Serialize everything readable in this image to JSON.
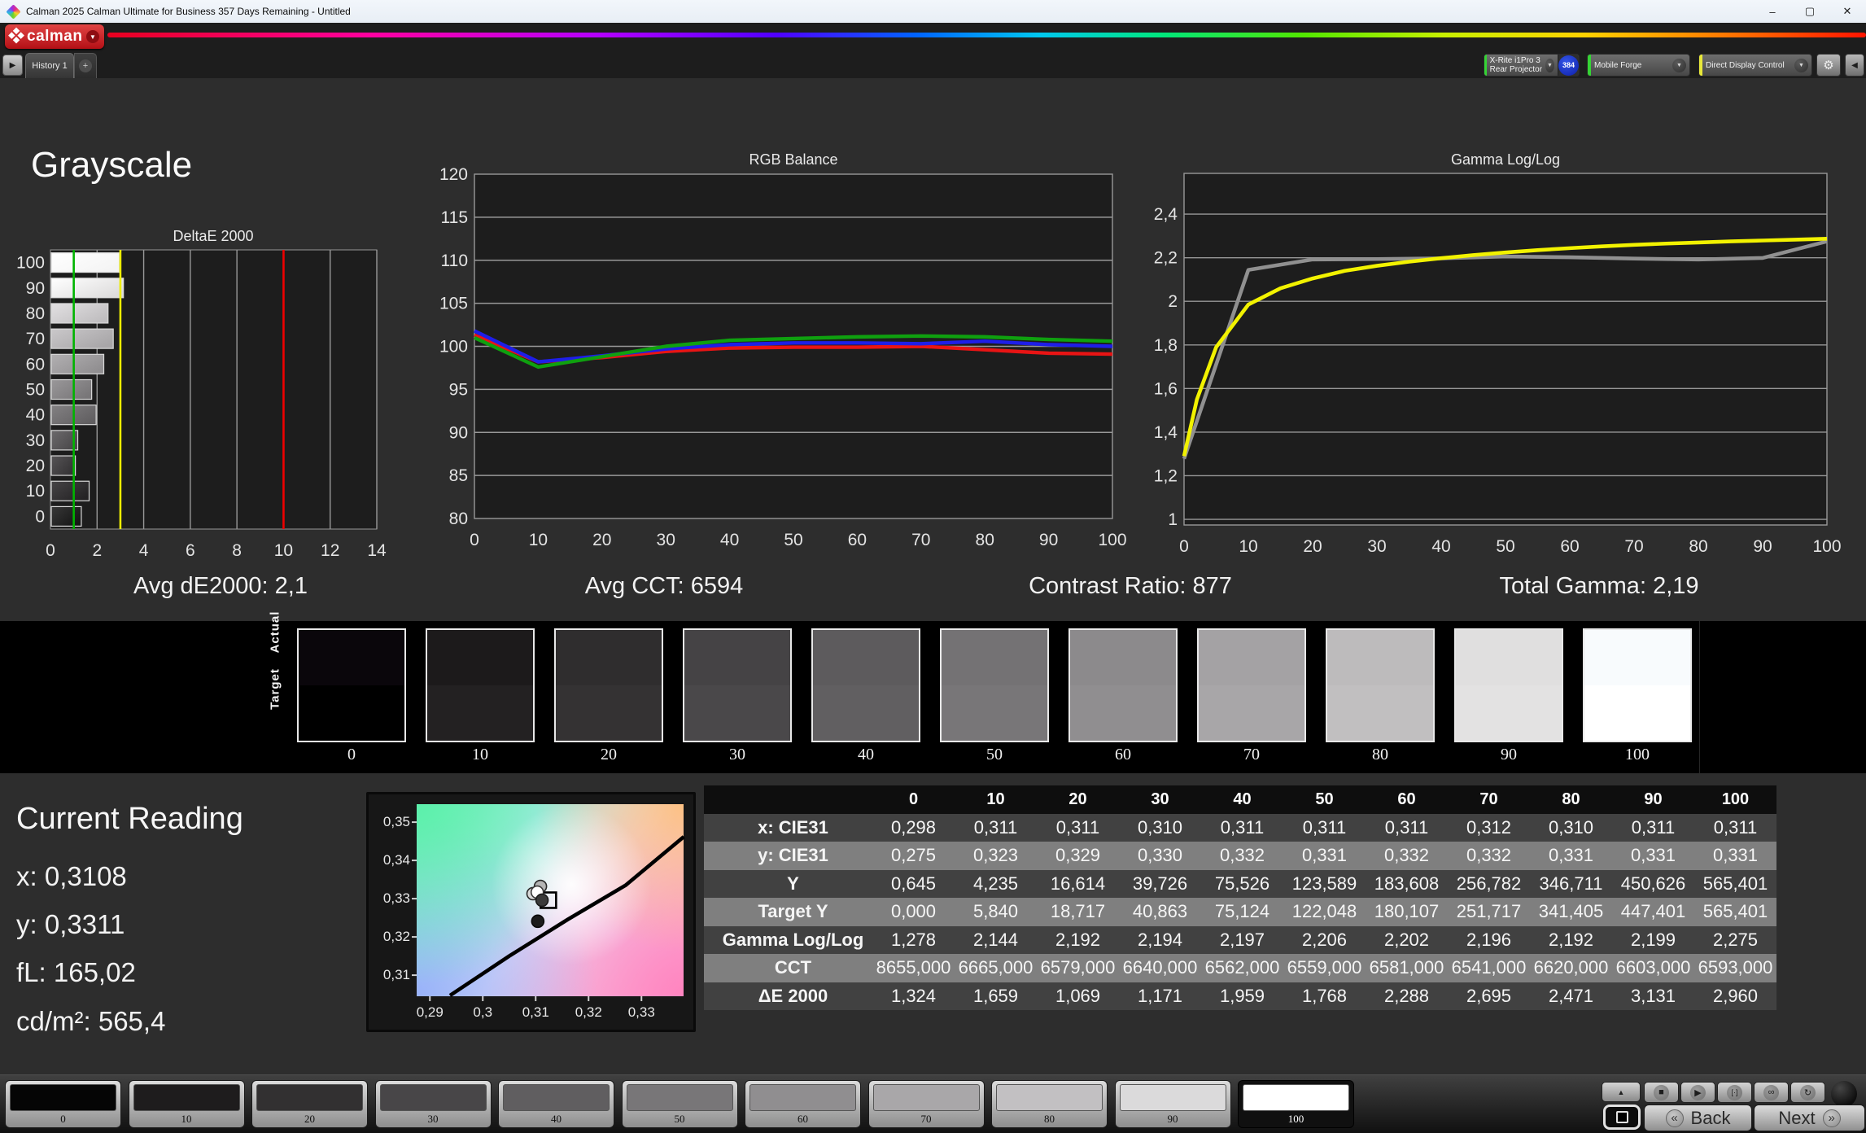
{
  "window": {
    "title": "Calman 2025 Calman Ultimate for Business 357 Days Remaining  - Untitled",
    "minimize": "–",
    "maximize": "▢",
    "close": "✕"
  },
  "brand": {
    "logo_text": "calman",
    "dropdown_glyph": "▼"
  },
  "toolbar": {
    "expander_glyph": "▶",
    "history_tab": "History 1",
    "add_tab": "+",
    "meter": {
      "line1": "X-Rite i1Pro 3",
      "line2": "Rear Projector",
      "badge": "384",
      "stripe_color": "#35d435"
    },
    "source": {
      "label": "Mobile Forge",
      "stripe_color": "#35d435"
    },
    "display": {
      "label": "Direct Display Control",
      "stripe_color": "#e8e83a"
    },
    "gear_glyph": "⚙",
    "collapse_glyph": "◀",
    "arrow_glyph": "▼"
  },
  "page": {
    "title": "Grayscale"
  },
  "chart_data": [
    {
      "type": "bar",
      "title": "DeltaE 2000",
      "orientation": "horizontal",
      "categories": [
        0,
        10,
        20,
        30,
        40,
        50,
        60,
        70,
        80,
        90,
        100
      ],
      "values": [
        1.324,
        1.659,
        1.069,
        1.171,
        1.959,
        1.768,
        2.288,
        2.695,
        2.471,
        3.131,
        2.96
      ],
      "bar_colors": [
        "#161616",
        "#242224",
        "#343234",
        "#4a484a",
        "#615f61",
        "#787678",
        "#908e90",
        "#a8a6a8",
        "#c0bec0",
        "#dedddd",
        "#f4f4f4"
      ],
      "xlabel": "",
      "ylabel": "",
      "xlim": [
        0,
        14
      ],
      "xticks": [
        "0",
        "2",
        "4",
        "6",
        "8",
        "10",
        "12",
        "14"
      ],
      "reference_lines": [
        {
          "value": 1,
          "color": "#00b400"
        },
        {
          "value": 3,
          "color": "#eded00"
        },
        {
          "value": 10,
          "color": "#ee0000"
        }
      ],
      "grid": true
    },
    {
      "type": "line",
      "title": "RGB Balance",
      "x": [
        0,
        10,
        20,
        30,
        40,
        50,
        60,
        70,
        80,
        90,
        100
      ],
      "xticks": [
        "0",
        "10",
        "20",
        "30",
        "40",
        "50",
        "60",
        "70",
        "80",
        "90",
        "100"
      ],
      "ylim": [
        80,
        120
      ],
      "yticks": [
        "80",
        "85",
        "90",
        "95",
        "100",
        "105",
        "110",
        "115",
        "120"
      ],
      "series": [
        {
          "name": "Red",
          "color": "#e81414",
          "values": [
            101.3,
            98.2,
            98.7,
            99.4,
            99.8,
            99.9,
            99.9,
            100.0,
            99.6,
            99.2,
            99.1
          ]
        },
        {
          "name": "Blue",
          "color": "#1e1ee8",
          "values": [
            101.8,
            98.2,
            98.9,
            99.7,
            100.2,
            100.4,
            100.4,
            100.3,
            100.6,
            100.2,
            100.0
          ]
        },
        {
          "name": "Green",
          "color": "#0fa00f",
          "values": [
            101.0,
            97.6,
            98.8,
            100.0,
            100.7,
            100.9,
            101.1,
            101.2,
            101.1,
            100.8,
            100.6
          ]
        }
      ],
      "grid": true
    },
    {
      "type": "line",
      "title": "Gamma Log/Log",
      "x": [
        0,
        10,
        20,
        30,
        40,
        50,
        60,
        70,
        80,
        90,
        100
      ],
      "xticks": [
        "0",
        "10",
        "20",
        "30",
        "40",
        "50",
        "60",
        "70",
        "80",
        "90",
        "100"
      ],
      "ylim": [
        0.974,
        2.587
      ],
      "ygrid_values": [
        1,
        1.2,
        1.4,
        1.6,
        1.8,
        2,
        2.2,
        2.4
      ],
      "yticks": [
        "1",
        "1,2",
        "1,4",
        "1,6",
        "1,8",
        "2",
        "2,2",
        "2,4"
      ],
      "series": [
        {
          "name": "Measured",
          "color": "#909090",
          "points": [
            [
              0,
              1.278
            ],
            [
              10,
              2.144
            ],
            [
              20,
              2.192
            ],
            [
              30,
              2.194
            ],
            [
              40,
              2.197
            ],
            [
              50,
              2.206
            ],
            [
              60,
              2.202
            ],
            [
              70,
              2.196
            ],
            [
              80,
              2.192
            ],
            [
              90,
              2.199
            ],
            [
              100,
              2.275
            ]
          ]
        },
        {
          "name": "Target",
          "color": "#f2f200",
          "points": [
            [
              0,
              1.29
            ],
            [
              2,
              1.55
            ],
            [
              5,
              1.79
            ],
            [
              10,
              1.985
            ],
            [
              15,
              2.06
            ],
            [
              20,
              2.105
            ],
            [
              25,
              2.14
            ],
            [
              30,
              2.163
            ],
            [
              35,
              2.182
            ],
            [
              40,
              2.198
            ],
            [
              45,
              2.212
            ],
            [
              50,
              2.224
            ],
            [
              55,
              2.235
            ],
            [
              60,
              2.244
            ],
            [
              65,
              2.252
            ],
            [
              70,
              2.259
            ],
            [
              75,
              2.265
            ],
            [
              80,
              2.27
            ],
            [
              85,
              2.275
            ],
            [
              90,
              2.279
            ],
            [
              95,
              2.283
            ],
            [
              100,
              2.287
            ]
          ]
        }
      ],
      "grid": true
    },
    {
      "type": "scatter",
      "title": "CIE xy detail",
      "xticks": [
        "0,29",
        "0,3",
        "0,31",
        "0,32",
        "0,33"
      ],
      "yticks": [
        "0,35",
        "0,34",
        "0,33",
        "0,32",
        "0,31"
      ],
      "xtick_values": [
        0.29,
        0.3,
        0.31,
        0.32,
        0.33
      ],
      "ytick_values": [
        0.35,
        0.34,
        0.33,
        0.32,
        0.31
      ],
      "locus": [
        [
          0.2938,
          0.3047
        ],
        [
          0.305,
          0.315
        ],
        [
          0.316,
          0.3245
        ],
        [
          0.327,
          0.3335
        ],
        [
          0.338,
          0.3462
        ]
      ],
      "points": [
        {
          "x": 0.3109,
          "y": 0.3332,
          "fill": "#b4b4b4",
          "stroke": "#2a2a2a"
        },
        {
          "x": 0.3095,
          "y": 0.3313,
          "fill": "#d8d8d8",
          "stroke": "#2a2a2a"
        },
        {
          "x": 0.3103,
          "y": 0.3317,
          "fill": "#ffffff",
          "stroke": "#3a3a3a"
        },
        {
          "x": 0.3112,
          "y": 0.3296,
          "fill": "#3a3a3a",
          "stroke": "#1a1a1a"
        },
        {
          "x": 0.3104,
          "y": 0.3241,
          "fill": "#1c1c1c",
          "stroke": "#0a0a0a"
        }
      ],
      "target_square": {
        "x": 0.3124,
        "y": 0.3296,
        "size": 19
      }
    }
  ],
  "summary": [
    {
      "label": "Avg dE2000",
      "value": "2,1"
    },
    {
      "label": "Avg CCT",
      "value": "6594"
    },
    {
      "label": "Contrast Ratio",
      "value": "877"
    },
    {
      "label": "Total Gamma",
      "value": "2,19"
    }
  ],
  "strip": {
    "row_labels": [
      "Actual",
      "Target"
    ],
    "levels": [
      "0",
      "10",
      "20",
      "30",
      "40",
      "50",
      "60",
      "70",
      "80",
      "90",
      "100"
    ],
    "actual_colors": [
      "#0a060b",
      "#1c1a1b",
      "#2f2d2e",
      "#454345",
      "#5d5b5d",
      "#747274",
      "#8c8a8c",
      "#a4a2a4",
      "#bdbbbc",
      "#e0dfdf",
      "#f8fbfd"
    ],
    "target_colors": [
      "#000000",
      "#232122",
      "#343233",
      "#4a484a",
      "#615f61",
      "#787678",
      "#908e90",
      "#a8a6a8",
      "#c1bfc0",
      "#e3e2e2",
      "#ffffff"
    ]
  },
  "current_reading": {
    "title": "Current Reading",
    "items": [
      {
        "label": "x:",
        "value": "0,3108"
      },
      {
        "label": "y:",
        "value": "0,3311"
      },
      {
        "label": "fL:",
        "value": "165,02"
      },
      {
        "label": "cd/m²:",
        "value": "565,4"
      }
    ]
  },
  "table": {
    "columns": [
      "0",
      "10",
      "20",
      "30",
      "40",
      "50",
      "60",
      "70",
      "80",
      "90",
      "100"
    ],
    "rows": [
      {
        "label": "x: CIE31",
        "shade": "dark",
        "values": [
          "0,298",
          "0,311",
          "0,311",
          "0,310",
          "0,311",
          "0,311",
          "0,311",
          "0,312",
          "0,310",
          "0,311",
          "0,311"
        ]
      },
      {
        "label": "y: CIE31",
        "shade": "light",
        "values": [
          "0,275",
          "0,323",
          "0,329",
          "0,330",
          "0,332",
          "0,331",
          "0,332",
          "0,332",
          "0,331",
          "0,331",
          "0,331"
        ]
      },
      {
        "label": "Y",
        "shade": "dark",
        "values": [
          "0,645",
          "4,235",
          "16,614",
          "39,726",
          "75,526",
          "123,589",
          "183,608",
          "256,782",
          "346,711",
          "450,626",
          "565,401"
        ]
      },
      {
        "label": "Target Y",
        "shade": "light",
        "values": [
          "0,000",
          "5,840",
          "18,717",
          "40,863",
          "75,124",
          "122,048",
          "180,107",
          "251,717",
          "341,405",
          "447,401",
          "565,401"
        ]
      },
      {
        "label": "Gamma Log/Log",
        "shade": "dark",
        "values": [
          "1,278",
          "2,144",
          "2,192",
          "2,194",
          "2,197",
          "2,206",
          "2,202",
          "2,196",
          "2,192",
          "2,199",
          "2,275"
        ]
      },
      {
        "label": "CCT",
        "shade": "light",
        "values": [
          "8655,000",
          "6665,000",
          "6579,000",
          "6640,000",
          "6562,000",
          "6559,000",
          "6581,000",
          "6541,000",
          "6620,000",
          "6603,000",
          "6593,000"
        ]
      },
      {
        "label": "ΔE 2000",
        "shade": "dark",
        "values": [
          "1,324",
          "1,659",
          "1,069",
          "1,171",
          "1,959",
          "1,768",
          "2,288",
          "2,695",
          "2,471",
          "3,131",
          "2,960"
        ]
      }
    ]
  },
  "bottom": {
    "levels": [
      "0",
      "10",
      "20",
      "30",
      "40",
      "50",
      "60",
      "70",
      "80",
      "90",
      "100"
    ],
    "swatch_colors": [
      "#050505",
      "#1e1c1d",
      "#323031",
      "#484648",
      "#605e60",
      "#787678",
      "#908e90",
      "#a9a7a9",
      "#c2c0c2",
      "#dbdadb",
      "#ffffff"
    ],
    "selected": "100",
    "icons": {
      "up": "▲",
      "stop": "■",
      "play": "▶",
      "range": "[·]",
      "infinity": "∞",
      "refresh": "↻"
    },
    "back_label": "Back",
    "next_label": "Next",
    "back_glyph": "«",
    "next_glyph": "»"
  }
}
